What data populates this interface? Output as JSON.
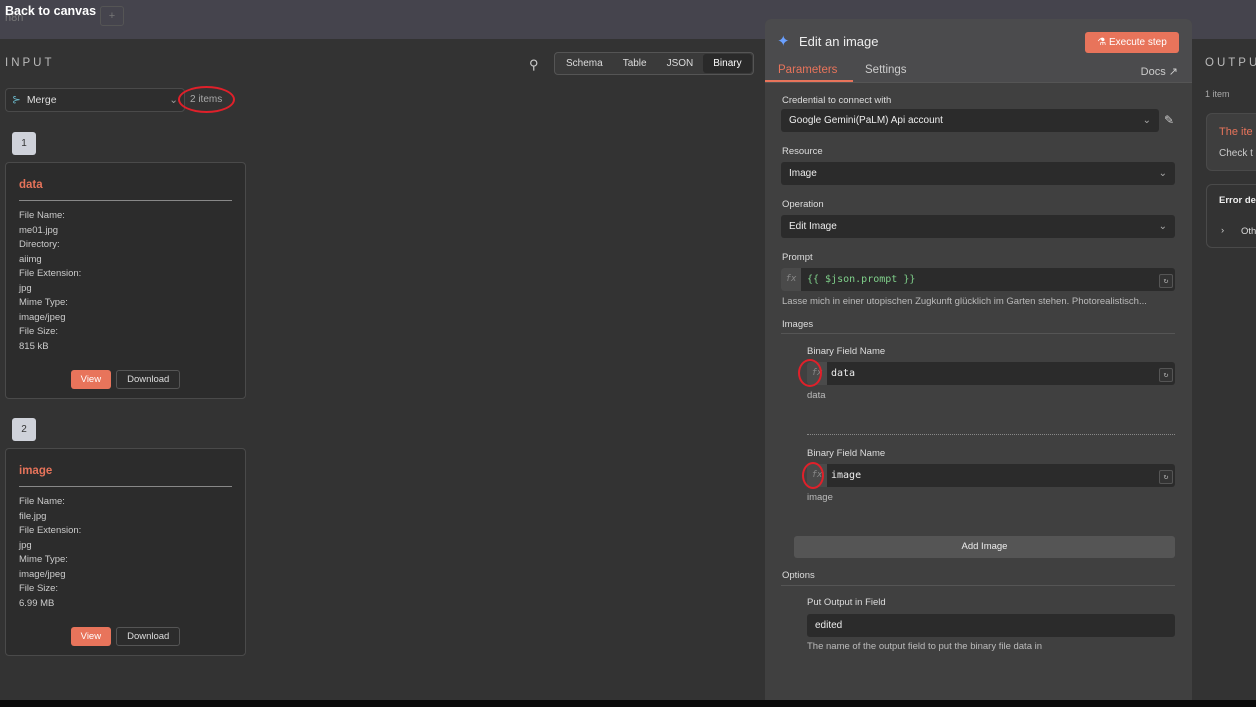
{
  "topbar": {
    "back": "Back to canvas",
    "ghost": "n8n",
    "plus": "+"
  },
  "input": {
    "title": "INPUT",
    "node": "Merge",
    "items_count": "2 items",
    "view_tabs": [
      "Schema",
      "Table",
      "JSON",
      "Binary"
    ],
    "active_tab": "Binary",
    "items": [
      {
        "index": "1",
        "key": "data",
        "fields": [
          [
            "File Name:",
            "me01.jpg"
          ],
          [
            "Directory:",
            "aiimg"
          ],
          [
            "File Extension:",
            "jpg"
          ],
          [
            "Mime Type:",
            "image/jpeg"
          ],
          [
            "File Size:",
            "815 kB"
          ]
        ]
      },
      {
        "index": "2",
        "key": "image",
        "fields": [
          [
            "File Name:",
            "file.jpg"
          ],
          [
            "File Extension:",
            "jpg"
          ],
          [
            "Mime Type:",
            "image/jpeg"
          ],
          [
            "File Size:",
            "6.99 MB"
          ]
        ]
      }
    ],
    "view_label": "View",
    "download_label": "Download"
  },
  "panel": {
    "title": "Edit an image",
    "execute": "Execute step",
    "tabs": [
      "Parameters",
      "Settings"
    ],
    "docs": "Docs ↗",
    "credential_label": "Credential to connect with",
    "credential_value": "Google Gemini(PaLM) Api account",
    "resource_label": "Resource",
    "resource_value": "Image",
    "operation_label": "Operation",
    "operation_value": "Edit Image",
    "prompt_label": "Prompt",
    "prompt_value": "{{ $json.prompt }}",
    "prompt_preview": "Lasse mich in einer utopischen Zugkunft glücklich im Garten stehen. Photorealistisch...",
    "images_label": "Images",
    "images": [
      {
        "label": "Binary Field Name",
        "value": "data",
        "hint": "data"
      },
      {
        "label": "Binary Field Name",
        "value": "image",
        "hint": "image"
      }
    ],
    "add_image": "Add Image",
    "options_label": "Options",
    "output_field_label": "Put Output in Field",
    "output_field_value": "edited",
    "output_field_hint": "The name of the output field to put the binary file data in",
    "fx": "fx"
  },
  "output": {
    "title": "OUTPUT",
    "items_count": "1 item",
    "error_title": "The ite",
    "error_text": "Check t",
    "error_details": "Error de",
    "other": "Oth"
  }
}
